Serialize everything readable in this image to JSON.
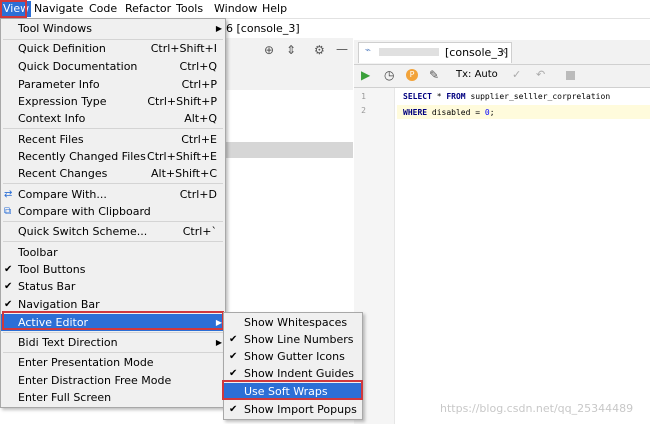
{
  "menubar": [
    "View",
    "Navigate",
    "Code",
    "Refactor",
    "Tools",
    "Window",
    "Help"
  ],
  "ide": {
    "title_fragment": "6 [console_3]",
    "tab_label": "[console_3]",
    "tx_label": "Tx: Auto",
    "code_lines": [
      {
        "num": "1",
        "text": "SELECT * FROM supplier_selller_corprelation"
      },
      {
        "num": "2",
        "text": "WHERE disabled = 0;"
      }
    ]
  },
  "view_menu": {
    "items": [
      {
        "label": "Tool Windows",
        "shortcut": "",
        "arrow": true
      },
      {
        "label": "Quick Definition",
        "shortcut": "Ctrl+Shift+I"
      },
      {
        "label": "Quick Documentation",
        "shortcut": "Ctrl+Q"
      },
      {
        "label": "Parameter Info",
        "shortcut": "Ctrl+P"
      },
      {
        "label": "Expression Type",
        "shortcut": "Ctrl+Shift+P"
      },
      {
        "label": "Context Info",
        "shortcut": "Alt+Q"
      },
      {
        "label": "Recent Files",
        "shortcut": "Ctrl+E"
      },
      {
        "label": "Recently Changed Files",
        "shortcut": "Ctrl+Shift+E"
      },
      {
        "label": "Recent Changes",
        "shortcut": "Alt+Shift+C"
      },
      {
        "label": "Compare With...",
        "shortcut": "Ctrl+D"
      },
      {
        "label": "Compare with Clipboard",
        "shortcut": ""
      },
      {
        "label": "Quick Switch Scheme...",
        "shortcut": "Ctrl+`"
      },
      {
        "label": "Toolbar",
        "shortcut": ""
      },
      {
        "label": "Tool Buttons",
        "shortcut": "",
        "checked": true
      },
      {
        "label": "Status Bar",
        "shortcut": "",
        "checked": true
      },
      {
        "label": "Navigation Bar",
        "shortcut": "",
        "checked": true
      },
      {
        "label": "Active Editor",
        "shortcut": "",
        "arrow": true,
        "highlighted": true
      },
      {
        "label": "Bidi Text Direction",
        "shortcut": "",
        "arrow": true
      },
      {
        "label": "Enter Presentation Mode",
        "shortcut": ""
      },
      {
        "label": "Enter Distraction Free Mode",
        "shortcut": ""
      },
      {
        "label": "Enter Full Screen",
        "shortcut": ""
      }
    ]
  },
  "active_editor_submenu": {
    "items": [
      {
        "label": "Show Whitespaces",
        "checked": false
      },
      {
        "label": "Show Line Numbers",
        "checked": true
      },
      {
        "label": "Show Gutter Icons",
        "checked": true
      },
      {
        "label": "Show Indent Guides",
        "checked": true
      },
      {
        "label": "Use Soft Wraps",
        "checked": false,
        "highlighted": true
      },
      {
        "label": "Show Import Popups",
        "checked": true
      }
    ]
  },
  "watermark": "https://blog.csdn.net/qq_25344489",
  "colors": {
    "highlight": "#2c6fd6",
    "annotation": "#d0383d"
  }
}
